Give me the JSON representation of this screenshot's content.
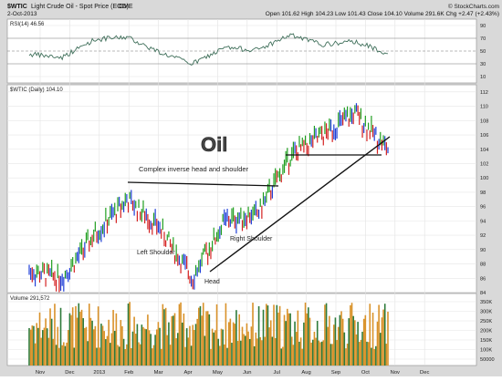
{
  "header": {
    "symbol": "$WTIC",
    "name": "Light Crude Oil - Spot Price (EOD)",
    "exchange": "CME",
    "brand": "© StockCharts.com",
    "date": "2-Oct-2013",
    "ohlc": "Open 101.62  High 104.23  Low 101.43  Close 104.10  Volume 291.6K  Chg +2.47 (+2.43%)"
  },
  "rsi_panel": {
    "label": "RSI(14) 46.56",
    "ticks": [
      "90",
      "70",
      "50",
      "30",
      "10"
    ]
  },
  "price_panel": {
    "label": "$WTIC (Daily) 104.10",
    "ticks": [
      "112",
      "110",
      "108",
      "106",
      "104",
      "102",
      "100",
      "98",
      "96",
      "94",
      "92",
      "90",
      "88",
      "86",
      "84"
    ],
    "big_label": "Oil",
    "annotations": {
      "complex": "Complex inverse head and shoulder",
      "left": "Left Shoulder",
      "right": "Right Shoulder",
      "head": "Head"
    }
  },
  "volume_panel": {
    "label": "Volume 291,572",
    "ticks": [
      "350K",
      "300K",
      "250K",
      "200K",
      "150K",
      "100K",
      "50000"
    ]
  },
  "x_axis": {
    "labels": [
      "Nov",
      "Dec",
      "2013",
      "Feb",
      "Mar",
      "Apr",
      "May",
      "Jun",
      "Jul",
      "Aug",
      "Sep",
      "Oct",
      "Nov",
      "Dec"
    ]
  },
  "chart_data": {
    "type": "line",
    "title": "$WTIC Light Crude Oil - Spot Price (EOD)",
    "ylim": [
      84,
      113
    ],
    "x": [
      "Nov",
      "Dec",
      "2013",
      "Feb",
      "Mar",
      "Apr",
      "May",
      "Jun",
      "Jul",
      "Aug",
      "Sep",
      "Oct"
    ],
    "series": [
      {
        "name": "$WTIC (Daily)",
        "values": [
          87,
          86,
          92,
          97,
          93,
          86,
          94,
          95,
          103,
          106,
          109,
          104
        ]
      }
    ],
    "rsi_values": [
      45,
      40,
      68,
      72,
      48,
      30,
      55,
      52,
      75,
      60,
      65,
      46.56
    ],
    "colors": {
      "up": "#1f9e1f",
      "down": "#d42020",
      "neutral": "#1f3fd8",
      "rsi_line": "#3f6f5a",
      "volume_up": "#d9922a",
      "volume_down": "#2d7a3a"
    }
  }
}
